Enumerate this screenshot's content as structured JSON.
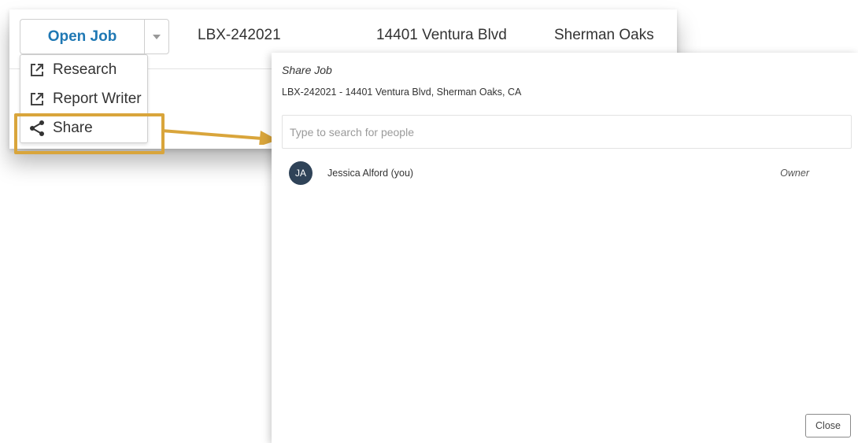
{
  "job_row": {
    "open_button_label": "Open Job",
    "job_id": "LBX-242021",
    "address": "14401 Ventura Blvd",
    "city": "Sherman Oaks"
  },
  "menu": {
    "items": [
      {
        "label": "Research",
        "icon": "external-link-icon"
      },
      {
        "label": "Report Writer",
        "icon": "external-link-icon"
      },
      {
        "label": "Share",
        "icon": "share-icon"
      }
    ]
  },
  "dialog": {
    "title": "Share Job",
    "subtitle": "LBX-242021 - 14401 Ventura Blvd, Sherman Oaks, CA",
    "search_placeholder": "Type to search for people",
    "people": [
      {
        "initials": "JA",
        "name": "Jessica Alford (you)",
        "role": "Owner"
      }
    ],
    "close_label": "Close"
  },
  "colors": {
    "link_blue": "#1f78b4",
    "highlight_gold": "#d9a53b",
    "avatar_bg": "#2f4358"
  }
}
